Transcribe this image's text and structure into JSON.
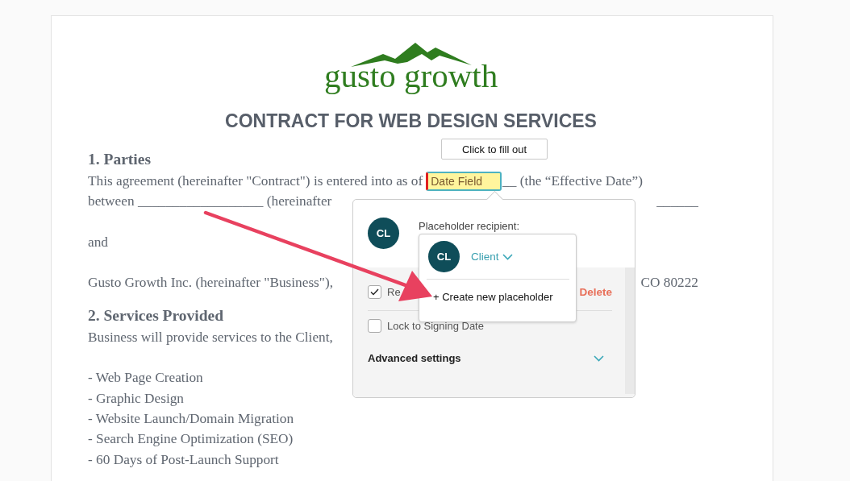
{
  "logo": {
    "text": "gusto growth"
  },
  "document": {
    "title": "CONTRACT FOR WEB DESIGN SERVICES",
    "blocks": [
      {
        "kind": "heading",
        "text": "1. Parties"
      },
      {
        "kind": "field_line",
        "left": "This agreement (hereinafter \"Contract\") is entered into as of",
        "field": "Date Field",
        "right": "__ (the “Effective Date”)"
      },
      {
        "kind": "line",
        "left": "between __________________ (hereinafter",
        "right": "______"
      },
      {
        "kind": "gap"
      },
      {
        "kind": "line",
        "left": "and"
      },
      {
        "kind": "gap"
      },
      {
        "kind": "line",
        "left": "Gusto Growth Inc. (hereinafter \"Business\"),",
        "right": "CO 80222"
      },
      {
        "kind": "heading",
        "text": "2. Services Provided"
      },
      {
        "kind": "line",
        "left": "Business will provide services to the Client,"
      },
      {
        "kind": "gap"
      },
      {
        "kind": "line",
        "left": "- Web Page Creation"
      },
      {
        "kind": "line",
        "left": "- Graphic Design"
      },
      {
        "kind": "line",
        "left": "- Website Launch/Domain Migration"
      },
      {
        "kind": "line",
        "left": "- Search Engine Optimization (SEO)"
      },
      {
        "kind": "line",
        "left": "- 60 Days of Post-Launch Support"
      }
    ]
  },
  "tooltip": {
    "text": "Click to fill out"
  },
  "popup": {
    "avatar": "CL",
    "recipient_label": "Placeholder recipient:",
    "options": [
      {
        "label": "Re",
        "checked": true
      },
      {
        "label": "Lock to Signing Date",
        "checked": false
      }
    ],
    "delete_label": "Delete",
    "advanced": {
      "label": "Advanced settings",
      "expanded": false
    }
  },
  "dropdown": {
    "avatar": "CL",
    "selected": "Client",
    "action": "+ Create new placeholder"
  }
}
